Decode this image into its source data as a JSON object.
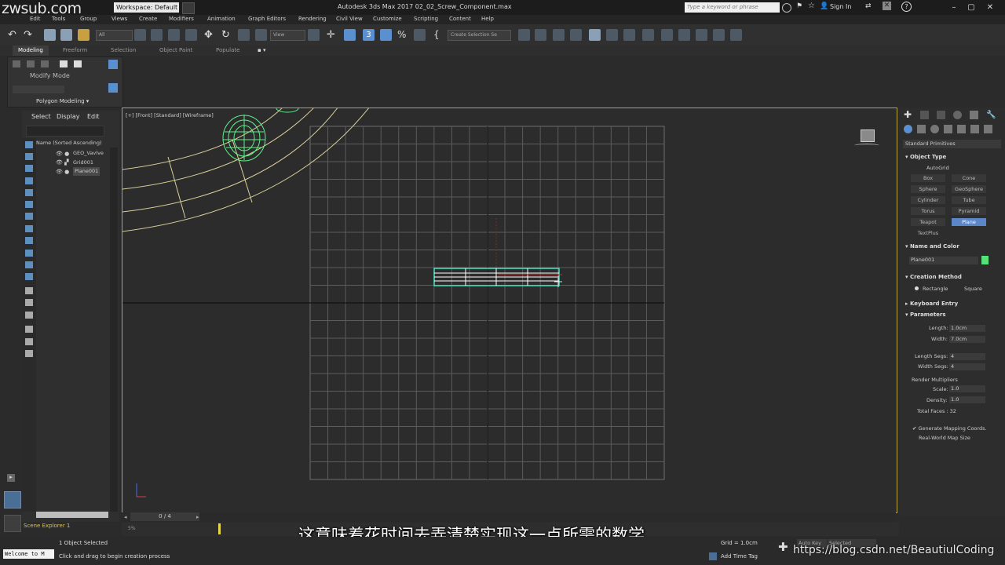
{
  "titlebar": {
    "watermark": "zwsub.com",
    "workspace": "Workspace: Default",
    "app_title": "Autodesk 3ds Max 2017    02_02_Screw_Component.max",
    "search_placeholder": "Type a keyword or phrase",
    "sign_in": "Sign In"
  },
  "menubar": {
    "items": [
      "Edit",
      "Tools",
      "Group",
      "Views",
      "Create",
      "Modifiers",
      "Animation",
      "Graph Editors",
      "Rendering",
      "Civil View",
      "Customize",
      "Scripting",
      "Content",
      "Help"
    ]
  },
  "toolbar": {
    "filter_value": "All",
    "view_value": "View",
    "selection_set_placeholder": "Create Selection Se"
  },
  "ribbon": {
    "tabs": [
      "Modeling",
      "Freeform",
      "Selection",
      "Object Paint",
      "Populate"
    ],
    "active_tab": "Modeling",
    "mode_label": "Modify Mode",
    "sub_label": "Polygon Modeling ▾"
  },
  "scene_explorer": {
    "tabs": [
      "Select",
      "Display",
      "Edit"
    ],
    "header": "Name (Sorted Ascending)",
    "rows": [
      {
        "name": "GEO_Vavlve",
        "selected": false
      },
      {
        "name": "Grid001",
        "selected": false
      },
      {
        "name": "Plane001",
        "selected": true
      }
    ],
    "footer": "Scene Explorer 1"
  },
  "viewport": {
    "label": "[+] [Front] [Standard] [Wireframe]"
  },
  "timeline": {
    "slider": "0 / 4",
    "range_label": "5%"
  },
  "command_panel": {
    "category": "Standard Primitives",
    "object_type_title": "Object Type",
    "autogrid": "AutoGrid",
    "primitives": [
      "Box",
      "Cone",
      "Sphere",
      "GeoSphere",
      "Cylinder",
      "Tube",
      "Torus",
      "Pyramid",
      "Teapot",
      "Plane",
      "TextPlus"
    ],
    "active_primitive": "Plane",
    "name_color_title": "Name and Color",
    "object_name": "Plane001",
    "object_color": "#56e07a",
    "creation_method_title": "Creation Method",
    "creation_options": [
      "Rectangle",
      "Square"
    ],
    "keyboard_entry_title": "Keyboard Entry",
    "parameters_title": "Parameters",
    "length_label": "Length:",
    "length_value": "1.0cm",
    "width_label": "Width:",
    "width_value": "7.0cm",
    "length_segs_label": "Length Segs:",
    "length_segs_value": "4",
    "width_segs_label": "Width Segs:",
    "width_segs_value": "4",
    "render_multipliers": "Render Multipliers",
    "scale_label": "Scale:",
    "scale_value": "1.0",
    "density_label": "Density:",
    "density_value": "1.0",
    "total_faces": "Total Faces : 32",
    "gen_mapping": "Generate Mapping Coords.",
    "real_world": "Real-World Map Size"
  },
  "statusbar": {
    "welcome": "Welcome to M",
    "selection_status": "1 Object Selected",
    "prompt": "Click and drag to begin creation process",
    "grid": "Grid = 1.0cm",
    "add_time_tag": "Add Time Tag",
    "auto_key": "Auto Key",
    "selected_dd": "Selected"
  },
  "subtitle": "这意味着花时间去弄清楚实现这一点所需的数学",
  "overlay_url": "https://blog.csdn.net/BeautiulCoding",
  "colors": {
    "viewport_border": "#b9a63a",
    "selection_cyan": "#4de0c0",
    "accent_blue": "#5b87c9",
    "valve_green": "#5ef08a"
  }
}
